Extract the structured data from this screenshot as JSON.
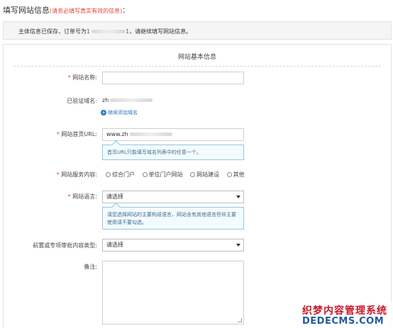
{
  "header": {
    "title": "填写网站信息",
    "hint": "(请务必填写真实有效的信息)",
    "colon": "："
  },
  "notice": {
    "prefix": "主体信息已保存，订单号为",
    "order_start": "1",
    "order_end": "1",
    "suffix": "，请继续填写网站信息。"
  },
  "form": {
    "section_title": "网站基本信息",
    "required_mark": "*",
    "site_name": {
      "label": "网站名称:",
      "value": ""
    },
    "verified_domain": {
      "label": "已验证域名:",
      "value": "zh",
      "add_link": "继续添加域名",
      "add_icon": "plus-circle-icon"
    },
    "homepage_url": {
      "label": "网站首页URL:",
      "value": "www.zh",
      "tip": "首页URL只能填写域名列表中的任意一个。"
    },
    "service_content": {
      "label": "网站服务内容:",
      "options": [
        "综合门户",
        "单位门户网站",
        "网站建设",
        "其他"
      ]
    },
    "language": {
      "label": "网站语言:",
      "selected": "请选择",
      "tip": "请您选择网站的主要构成语言，网站含有其他语言但非主要使用请不要勾选。"
    },
    "pre_approval": {
      "label": "前置或专项审批内容类型:",
      "selected": "请选择"
    },
    "remarks": {
      "label": "备注:"
    }
  },
  "watermark": {
    "line1": "织梦内容管理系统",
    "line2": "DEDECMS.COM"
  },
  "colors": {
    "required": "#e0473a",
    "link": "#2b74c0",
    "tip_border": "#8cc8e6",
    "watermark_red": "#c8192a",
    "watermark_blue": "#1f5aa6"
  }
}
